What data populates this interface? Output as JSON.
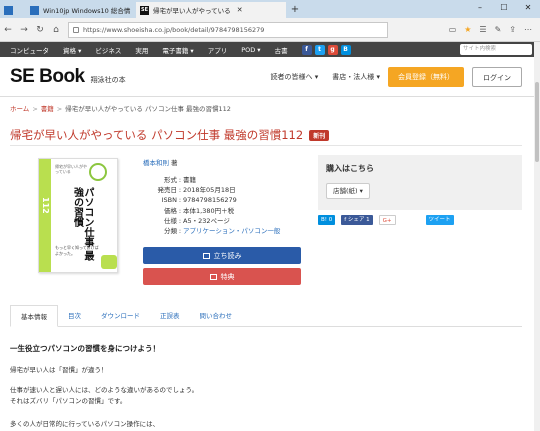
{
  "browser": {
    "tabs": [
      {
        "label": "",
        "fav_color": "#2a6ebb"
      },
      {
        "label": "Win10jp Windows10 総合情",
        "fav_color": "#2a6ebb"
      },
      {
        "label": "帰宅が早い人がやっている",
        "fav_color": "#111111"
      }
    ],
    "url": "https://www.shoeisha.co.jp/book/detail/9784798156279"
  },
  "topnav": {
    "items": [
      "コンピュータ",
      "資格 ▾",
      "ビジネス",
      "実用",
      "電子書籍 ▾",
      "アプリ",
      "POD ▾",
      "古書"
    ],
    "search_placeholder": "サイト内検索"
  },
  "header": {
    "logo": "SE Book",
    "logo_sub": "翔泳社の本",
    "links": [
      "読者の皆様へ ▾",
      "書店・法人様 ▾"
    ],
    "register": "会員登録（無料）",
    "login": "ログイン"
  },
  "breadcrumb": {
    "home": "ホーム",
    "books": "書籍",
    "current": "帰宅が早い人がやっている パソコン仕事 最強の習慣112"
  },
  "book": {
    "title": "帰宅が早い人がやっている パソコン仕事 最強の習慣112",
    "new_badge": "新刊",
    "author": "橋本和則",
    "author_suffix": "著",
    "meta": [
      {
        "k": "形式",
        "v": "書籍"
      },
      {
        "k": "発売日",
        "v": "2018年05月18日"
      },
      {
        "k": "ISBN",
        "v": "9784798156279"
      },
      {
        "k": "価格",
        "v": "本体1,380円＋税"
      },
      {
        "k": "仕様",
        "v": "A5・232ページ"
      },
      {
        "k": "分類",
        "v": "アプリケーション・パソコン一般"
      }
    ],
    "cover": {
      "top_text": "帰宅が早い人がやっている",
      "number": "112",
      "big": "パソコン仕事 最強の習慣",
      "note": "もっと早く知っておけばよかった。"
    },
    "btn_browse": "立ち読み",
    "btn_bonus": "特典"
  },
  "buy": {
    "heading": "購入はこちら",
    "select": "店舗(紙) ▾"
  },
  "share": {
    "hatena": "B! 0",
    "fb": "f シェア 1",
    "g": "G+",
    "tw": "ツイート"
  },
  "tabs": [
    "基本情報",
    "目次",
    "ダウンロード",
    "正誤表",
    "問い合わせ"
  ],
  "content": {
    "heading": "一生役立つパソコンの習慣を身につけよう！",
    "lines": [
      "帰宅が早い人は「習慣」が違う！",
      "仕事が速い人と遅い人には、どのような違いがあるのでしょう。",
      "それはズバリ「パソコンの習慣」です。",
      "多くの人が日常的に行っているパソコン操作には、"
    ]
  },
  "colors": {
    "accent_red": "#c0392b",
    "link_blue": "#2a6ebb",
    "orange": "#f5a623",
    "cover_green": "#b9df4f"
  }
}
